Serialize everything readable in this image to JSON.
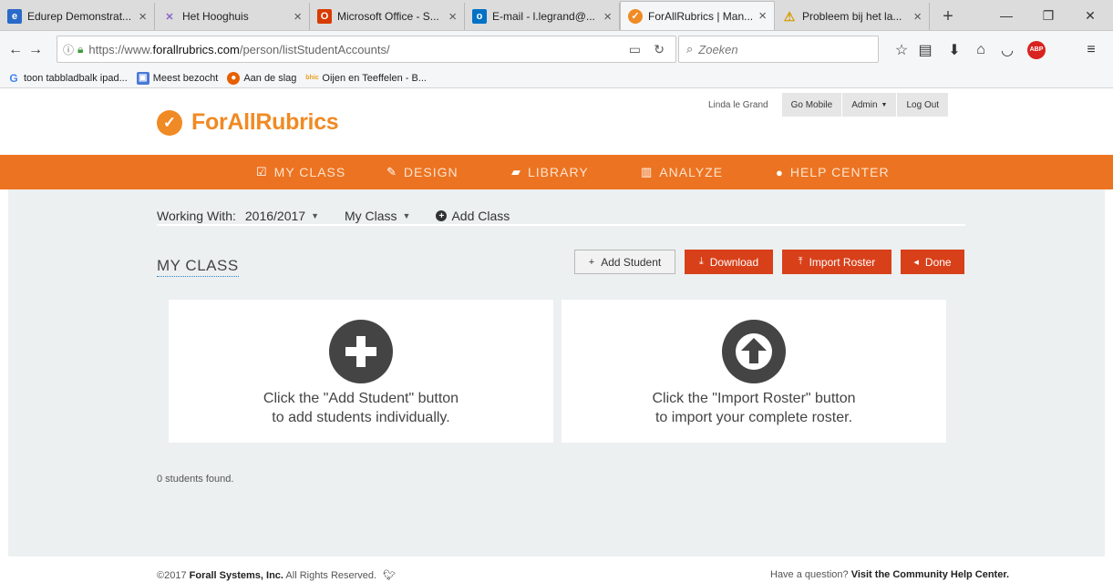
{
  "browser": {
    "tabs": [
      {
        "label": "Edurep Demonstrat...",
        "icon": "edurep-icon",
        "color": "#2a6ac8"
      },
      {
        "label": "Het Hooghuis",
        "icon": "hooghuis-icon",
        "color": "#8a64c8"
      },
      {
        "label": "Microsoft Office - S...",
        "icon": "office-icon",
        "color": "#d83b01"
      },
      {
        "label": "E-mail - l.legrand@...",
        "icon": "outlook-icon",
        "color": "#0072c6"
      },
      {
        "label": "ForAllRubrics | Man...",
        "icon": "forallrubrics-icon",
        "color": "#f08a24",
        "active": true
      },
      {
        "label": "Probleem bij het la...",
        "icon": "warning-icon",
        "color": "#f0b400"
      }
    ],
    "url": {
      "prefix": "https://www.",
      "host": "forallrubrics.com",
      "path": "/person/listStudentAccounts/"
    },
    "search_placeholder": "Zoeken",
    "bookmarks": [
      {
        "label": "toon tabbladbalk ipad...",
        "icon": "google-icon",
        "color": "#4285f4"
      },
      {
        "label": "Meest bezocht",
        "icon": "bookmark-folder-icon",
        "color": "#4a7ad8"
      },
      {
        "label": "Aan de slag",
        "icon": "firefox-icon",
        "color": "#e66000"
      },
      {
        "label": "Oijen en Teeffelen - B...",
        "icon": "bhic-icon",
        "color": "#e8a020"
      }
    ]
  },
  "site": {
    "logo": {
      "bold": "ForAll",
      "rest": "Rubrics"
    },
    "user_nav": {
      "name": "Linda le Grand",
      "go_mobile": "Go Mobile",
      "admin": "Admin",
      "logout": "Log Out"
    },
    "main_nav": [
      "MY CLASS",
      "DESIGN",
      "LIBRARY",
      "ANALYZE",
      "HELP CENTER"
    ],
    "working_with": {
      "label": "Working With:",
      "year": "2016/2017",
      "class": "My Class",
      "add_class": "Add Class"
    },
    "title": "MY CLASS",
    "buttons": {
      "add_student": "Add Student",
      "download": "Download",
      "import_roster": "Import Roster",
      "done": "Done"
    },
    "cards": [
      {
        "line1": "Click the \"Add Student\" button",
        "line2": "to add students individually."
      },
      {
        "line1": "Click the \"Import Roster\" button",
        "line2": "to import your complete roster."
      }
    ],
    "count_text": "0 students found.",
    "footer": {
      "copyright": "©2017",
      "company": "Forall Systems, Inc.",
      "rights": "All Rights Reserved.",
      "question": "Have a question?",
      "help_link": "Visit the Community Help Center."
    },
    "colors": {
      "brand_orange": "#ec7321",
      "button_red": "#d8401a",
      "content_bg": "#ecf0f1"
    }
  }
}
